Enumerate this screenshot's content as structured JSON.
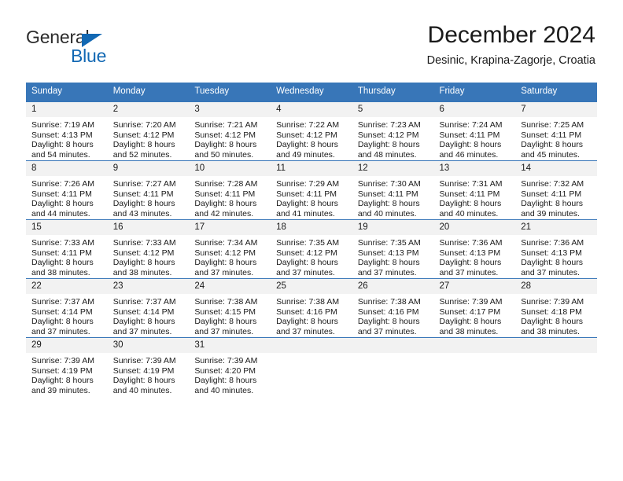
{
  "brand": {
    "name_part1": "General",
    "name_part2": "Blue",
    "triangle_color": "#1268b3",
    "icon": "triangle-icon"
  },
  "header": {
    "title": "December 2024",
    "subtitle": "Desinic, Krapina-Zagorje, Croatia"
  },
  "theme": {
    "header_blue": "#3876b8",
    "daynum_bg": "#f2f2f2",
    "text": "#1a1a1a",
    "brand_blue": "#1268b3"
  },
  "weekday_headers": [
    "Sunday",
    "Monday",
    "Tuesday",
    "Wednesday",
    "Thursday",
    "Friday",
    "Saturday"
  ],
  "weeks": [
    [
      {
        "day": "1",
        "sunrise": "Sunrise: 7:19 AM",
        "sunset": "Sunset: 4:13 PM",
        "daylight_line1": "Daylight: 8 hours",
        "daylight_line2": "and 54 minutes."
      },
      {
        "day": "2",
        "sunrise": "Sunrise: 7:20 AM",
        "sunset": "Sunset: 4:12 PM",
        "daylight_line1": "Daylight: 8 hours",
        "daylight_line2": "and 52 minutes."
      },
      {
        "day": "3",
        "sunrise": "Sunrise: 7:21 AM",
        "sunset": "Sunset: 4:12 PM",
        "daylight_line1": "Daylight: 8 hours",
        "daylight_line2": "and 50 minutes."
      },
      {
        "day": "4",
        "sunrise": "Sunrise: 7:22 AM",
        "sunset": "Sunset: 4:12 PM",
        "daylight_line1": "Daylight: 8 hours",
        "daylight_line2": "and 49 minutes."
      },
      {
        "day": "5",
        "sunrise": "Sunrise: 7:23 AM",
        "sunset": "Sunset: 4:12 PM",
        "daylight_line1": "Daylight: 8 hours",
        "daylight_line2": "and 48 minutes."
      },
      {
        "day": "6",
        "sunrise": "Sunrise: 7:24 AM",
        "sunset": "Sunset: 4:11 PM",
        "daylight_line1": "Daylight: 8 hours",
        "daylight_line2": "and 46 minutes."
      },
      {
        "day": "7",
        "sunrise": "Sunrise: 7:25 AM",
        "sunset": "Sunset: 4:11 PM",
        "daylight_line1": "Daylight: 8 hours",
        "daylight_line2": "and 45 minutes."
      }
    ],
    [
      {
        "day": "8",
        "sunrise": "Sunrise: 7:26 AM",
        "sunset": "Sunset: 4:11 PM",
        "daylight_line1": "Daylight: 8 hours",
        "daylight_line2": "and 44 minutes."
      },
      {
        "day": "9",
        "sunrise": "Sunrise: 7:27 AM",
        "sunset": "Sunset: 4:11 PM",
        "daylight_line1": "Daylight: 8 hours",
        "daylight_line2": "and 43 minutes."
      },
      {
        "day": "10",
        "sunrise": "Sunrise: 7:28 AM",
        "sunset": "Sunset: 4:11 PM",
        "daylight_line1": "Daylight: 8 hours",
        "daylight_line2": "and 42 minutes."
      },
      {
        "day": "11",
        "sunrise": "Sunrise: 7:29 AM",
        "sunset": "Sunset: 4:11 PM",
        "daylight_line1": "Daylight: 8 hours",
        "daylight_line2": "and 41 minutes."
      },
      {
        "day": "12",
        "sunrise": "Sunrise: 7:30 AM",
        "sunset": "Sunset: 4:11 PM",
        "daylight_line1": "Daylight: 8 hours",
        "daylight_line2": "and 40 minutes."
      },
      {
        "day": "13",
        "sunrise": "Sunrise: 7:31 AM",
        "sunset": "Sunset: 4:11 PM",
        "daylight_line1": "Daylight: 8 hours",
        "daylight_line2": "and 40 minutes."
      },
      {
        "day": "14",
        "sunrise": "Sunrise: 7:32 AM",
        "sunset": "Sunset: 4:11 PM",
        "daylight_line1": "Daylight: 8 hours",
        "daylight_line2": "and 39 minutes."
      }
    ],
    [
      {
        "day": "15",
        "sunrise": "Sunrise: 7:33 AM",
        "sunset": "Sunset: 4:11 PM",
        "daylight_line1": "Daylight: 8 hours",
        "daylight_line2": "and 38 minutes."
      },
      {
        "day": "16",
        "sunrise": "Sunrise: 7:33 AM",
        "sunset": "Sunset: 4:12 PM",
        "daylight_line1": "Daylight: 8 hours",
        "daylight_line2": "and 38 minutes."
      },
      {
        "day": "17",
        "sunrise": "Sunrise: 7:34 AM",
        "sunset": "Sunset: 4:12 PM",
        "daylight_line1": "Daylight: 8 hours",
        "daylight_line2": "and 37 minutes."
      },
      {
        "day": "18",
        "sunrise": "Sunrise: 7:35 AM",
        "sunset": "Sunset: 4:12 PM",
        "daylight_line1": "Daylight: 8 hours",
        "daylight_line2": "and 37 minutes."
      },
      {
        "day": "19",
        "sunrise": "Sunrise: 7:35 AM",
        "sunset": "Sunset: 4:13 PM",
        "daylight_line1": "Daylight: 8 hours",
        "daylight_line2": "and 37 minutes."
      },
      {
        "day": "20",
        "sunrise": "Sunrise: 7:36 AM",
        "sunset": "Sunset: 4:13 PM",
        "daylight_line1": "Daylight: 8 hours",
        "daylight_line2": "and 37 minutes."
      },
      {
        "day": "21",
        "sunrise": "Sunrise: 7:36 AM",
        "sunset": "Sunset: 4:13 PM",
        "daylight_line1": "Daylight: 8 hours",
        "daylight_line2": "and 37 minutes."
      }
    ],
    [
      {
        "day": "22",
        "sunrise": "Sunrise: 7:37 AM",
        "sunset": "Sunset: 4:14 PM",
        "daylight_line1": "Daylight: 8 hours",
        "daylight_line2": "and 37 minutes."
      },
      {
        "day": "23",
        "sunrise": "Sunrise: 7:37 AM",
        "sunset": "Sunset: 4:14 PM",
        "daylight_line1": "Daylight: 8 hours",
        "daylight_line2": "and 37 minutes."
      },
      {
        "day": "24",
        "sunrise": "Sunrise: 7:38 AM",
        "sunset": "Sunset: 4:15 PM",
        "daylight_line1": "Daylight: 8 hours",
        "daylight_line2": "and 37 minutes."
      },
      {
        "day": "25",
        "sunrise": "Sunrise: 7:38 AM",
        "sunset": "Sunset: 4:16 PM",
        "daylight_line1": "Daylight: 8 hours",
        "daylight_line2": "and 37 minutes."
      },
      {
        "day": "26",
        "sunrise": "Sunrise: 7:38 AM",
        "sunset": "Sunset: 4:16 PM",
        "daylight_line1": "Daylight: 8 hours",
        "daylight_line2": "and 37 minutes."
      },
      {
        "day": "27",
        "sunrise": "Sunrise: 7:39 AM",
        "sunset": "Sunset: 4:17 PM",
        "daylight_line1": "Daylight: 8 hours",
        "daylight_line2": "and 38 minutes."
      },
      {
        "day": "28",
        "sunrise": "Sunrise: 7:39 AM",
        "sunset": "Sunset: 4:18 PM",
        "daylight_line1": "Daylight: 8 hours",
        "daylight_line2": "and 38 minutes."
      }
    ],
    [
      {
        "day": "29",
        "sunrise": "Sunrise: 7:39 AM",
        "sunset": "Sunset: 4:19 PM",
        "daylight_line1": "Daylight: 8 hours",
        "daylight_line2": "and 39 minutes."
      },
      {
        "day": "30",
        "sunrise": "Sunrise: 7:39 AM",
        "sunset": "Sunset: 4:19 PM",
        "daylight_line1": "Daylight: 8 hours",
        "daylight_line2": "and 40 minutes."
      },
      {
        "day": "31",
        "sunrise": "Sunrise: 7:39 AM",
        "sunset": "Sunset: 4:20 PM",
        "daylight_line1": "Daylight: 8 hours",
        "daylight_line2": "and 40 minutes."
      },
      {
        "day": "",
        "sunrise": "",
        "sunset": "",
        "daylight_line1": "",
        "daylight_line2": ""
      },
      {
        "day": "",
        "sunrise": "",
        "sunset": "",
        "daylight_line1": "",
        "daylight_line2": ""
      },
      {
        "day": "",
        "sunrise": "",
        "sunset": "",
        "daylight_line1": "",
        "daylight_line2": ""
      },
      {
        "day": "",
        "sunrise": "",
        "sunset": "",
        "daylight_line1": "",
        "daylight_line2": ""
      }
    ]
  ]
}
